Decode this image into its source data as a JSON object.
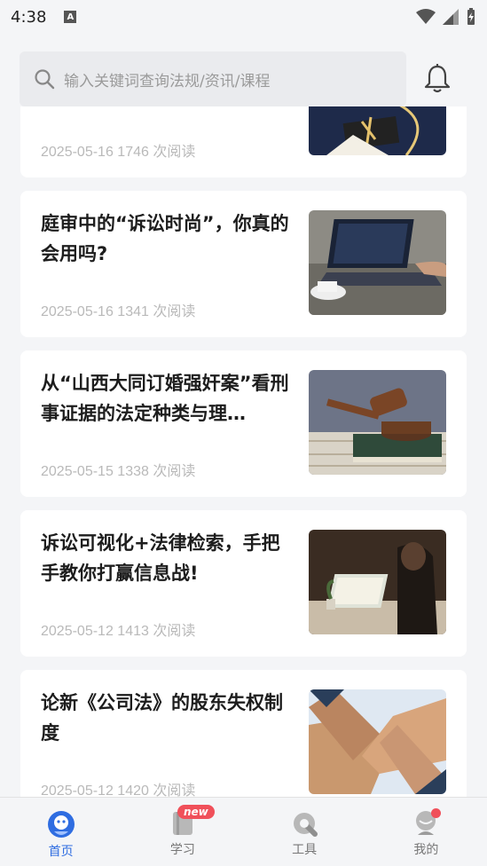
{
  "status_bar": {
    "time": "4:38",
    "a_icon": "A"
  },
  "search": {
    "placeholder": "输入关键词查询法规/资讯/课程"
  },
  "articles": [
    {
      "title": "",
      "date": "2025-05-16",
      "reads": "1746 次阅读"
    },
    {
      "title": "庭审中的“诉讼时尚”，你真的会用吗?",
      "date": "2025-05-16",
      "reads": "1341 次阅读"
    },
    {
      "title": "从“山西大同订婚强奸案”看刑事证据的法定种类与理…",
      "date": "2025-05-15",
      "reads": "1338 次阅读"
    },
    {
      "title": "诉讼可视化+法律检索，手把手教你打赢信息战!",
      "date": "2025-05-12",
      "reads": "1413 次阅读"
    },
    {
      "title": "论新《公司法》的股东失权制度",
      "date": "2025-05-12",
      "reads": "1420 次阅读"
    }
  ],
  "tabs": [
    {
      "label": "首页",
      "icon": "home-icon"
    },
    {
      "label": "学习",
      "icon": "book-icon",
      "badge": "new"
    },
    {
      "label": "工具",
      "icon": "wrench-icon"
    },
    {
      "label": "我的",
      "icon": "profile-icon"
    }
  ],
  "colors": {
    "accent": "#2f6de1",
    "badge": "#f0505a"
  }
}
